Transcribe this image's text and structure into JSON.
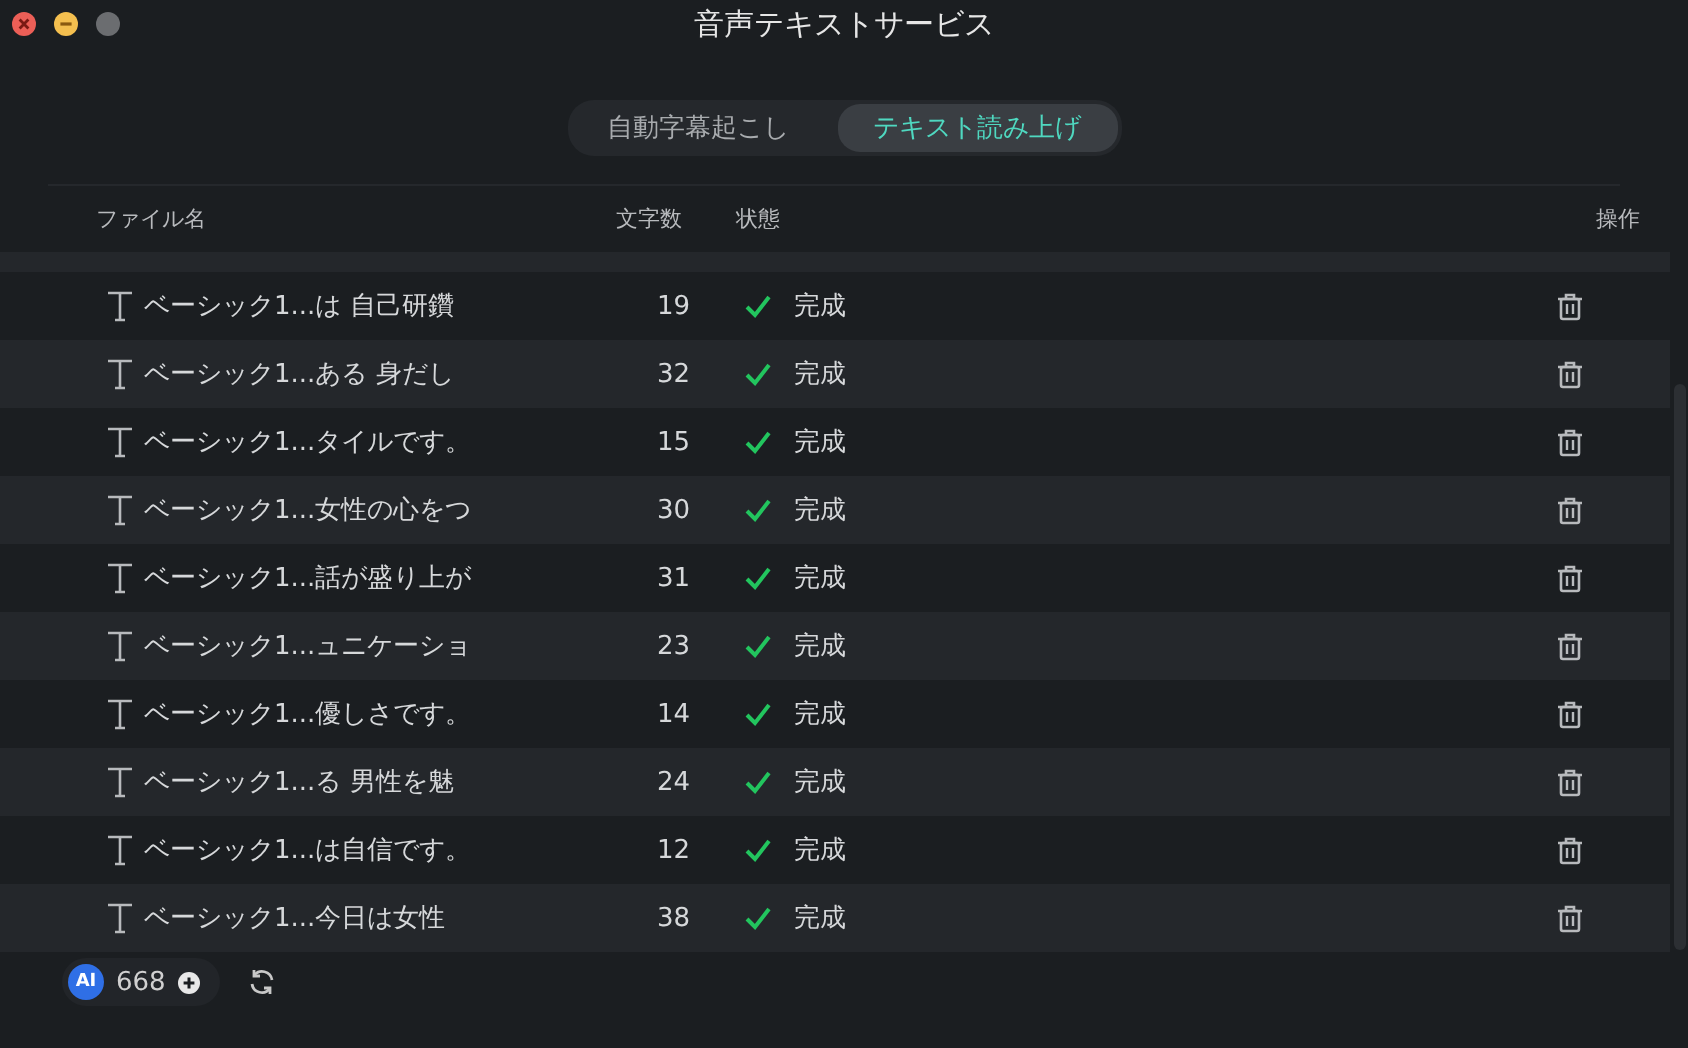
{
  "window": {
    "title": "音声テキストサービス"
  },
  "tabs": [
    {
      "label": "自動字幕起こし",
      "selected": false
    },
    {
      "label": "テキスト読み上げ",
      "selected": true
    }
  ],
  "table": {
    "columns": [
      "ファイル名",
      "文字数",
      "状態",
      "操作"
    ],
    "rows": [
      {
        "name": "ベーシック1...は 自己研鑽",
        "count": "19",
        "status": "完成"
      },
      {
        "name": "ベーシック1...ある 身だし",
        "count": "32",
        "status": "完成"
      },
      {
        "name": "ベーシック1...タイルです。",
        "count": "15",
        "status": "完成"
      },
      {
        "name": "ベーシック1...女性の心をつ",
        "count": "30",
        "status": "完成"
      },
      {
        "name": "ベーシック1...話が盛り上が",
        "count": "31",
        "status": "完成"
      },
      {
        "name": "ベーシック1...ュニケーショ",
        "count": "23",
        "status": "完成"
      },
      {
        "name": "ベーシック1...優しさです。",
        "count": "14",
        "status": "完成"
      },
      {
        "name": "ベーシック1...る 男性を魅",
        "count": "24",
        "status": "完成"
      },
      {
        "name": "ベーシック1...は自信です。",
        "count": "12",
        "status": "完成"
      },
      {
        "name": "ベーシック1...今日は女性",
        "count": "38",
        "status": "完成"
      }
    ]
  },
  "footer": {
    "ai_label": "AI",
    "credits": "668"
  }
}
